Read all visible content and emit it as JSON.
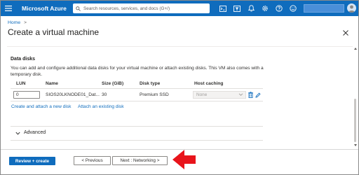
{
  "topbar": {
    "brand": "Microsoft Azure",
    "search_placeholder": "Search resources, services, and docs (G+/)",
    "accent": "#0f6cbd",
    "icons": [
      "cloud-shell-icon",
      "directory-filter-icon",
      "notifications-icon",
      "settings-icon",
      "help-icon",
      "feedback-icon"
    ]
  },
  "breadcrumb": {
    "home": "Home",
    "separator": ">"
  },
  "page": {
    "title": "Create a virtual machine"
  },
  "data_disks": {
    "title": "Data disks",
    "description": "You can add and configure additional data disks for your virtual machine or attach existing disks. This VM also comes with a temporary disk.",
    "columns": [
      "LUN",
      "Name",
      "Size (GiB)",
      "Disk type",
      "Host caching"
    ],
    "row": {
      "lun": "0",
      "name": "SIOS20LKNODE01_Dat...",
      "size": "30",
      "disk_type": "Premium SSD",
      "host_caching": "None"
    },
    "create_link": "Create and attach a new disk",
    "attach_link": "Attach an existing disk"
  },
  "advanced": {
    "label": "Advanced"
  },
  "footer": {
    "review_create": "Review + create",
    "previous": "< Previous",
    "next": "Next : Networking >"
  },
  "annotation": {
    "arrow_color": "#e8141b"
  }
}
